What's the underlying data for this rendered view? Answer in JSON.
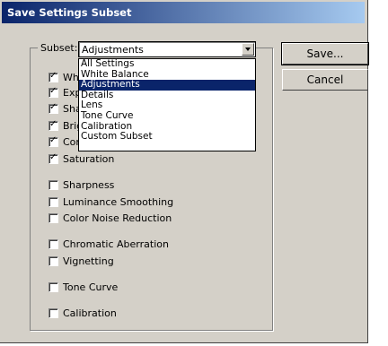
{
  "window": {
    "title": "Save Settings Subset"
  },
  "subset": {
    "label": "Subset:",
    "selected": "Adjustments",
    "options": [
      "All Settings",
      "White Balance",
      "Adjustments",
      "Details",
      "Lens",
      "Tone Curve",
      "Calibration",
      "Custom Subset"
    ]
  },
  "checkboxes": {
    "white_balance": {
      "label": "White Balance",
      "checked": true
    },
    "exposure": {
      "label": "Exposure",
      "checked": true
    },
    "shadows": {
      "label": "Shadows",
      "checked": true
    },
    "brightness": {
      "label": "Brightness",
      "checked": true
    },
    "contrast": {
      "label": "Contrast",
      "checked": true
    },
    "saturation": {
      "label": "Saturation",
      "checked": true
    },
    "sharpness": {
      "label": "Sharpness",
      "checked": false
    },
    "luminance_smoothing": {
      "label": "Luminance Smoothing",
      "checked": false
    },
    "color_noise_reduction": {
      "label": "Color Noise Reduction",
      "checked": false
    },
    "chromatic_aberration": {
      "label": "Chromatic Aberration",
      "checked": false
    },
    "vignetting": {
      "label": "Vignetting",
      "checked": false
    },
    "tone_curve": {
      "label": "Tone Curve",
      "checked": false
    },
    "calibration": {
      "label": "Calibration",
      "checked": false
    }
  },
  "buttons": {
    "save": "Save...",
    "cancel": "Cancel"
  }
}
